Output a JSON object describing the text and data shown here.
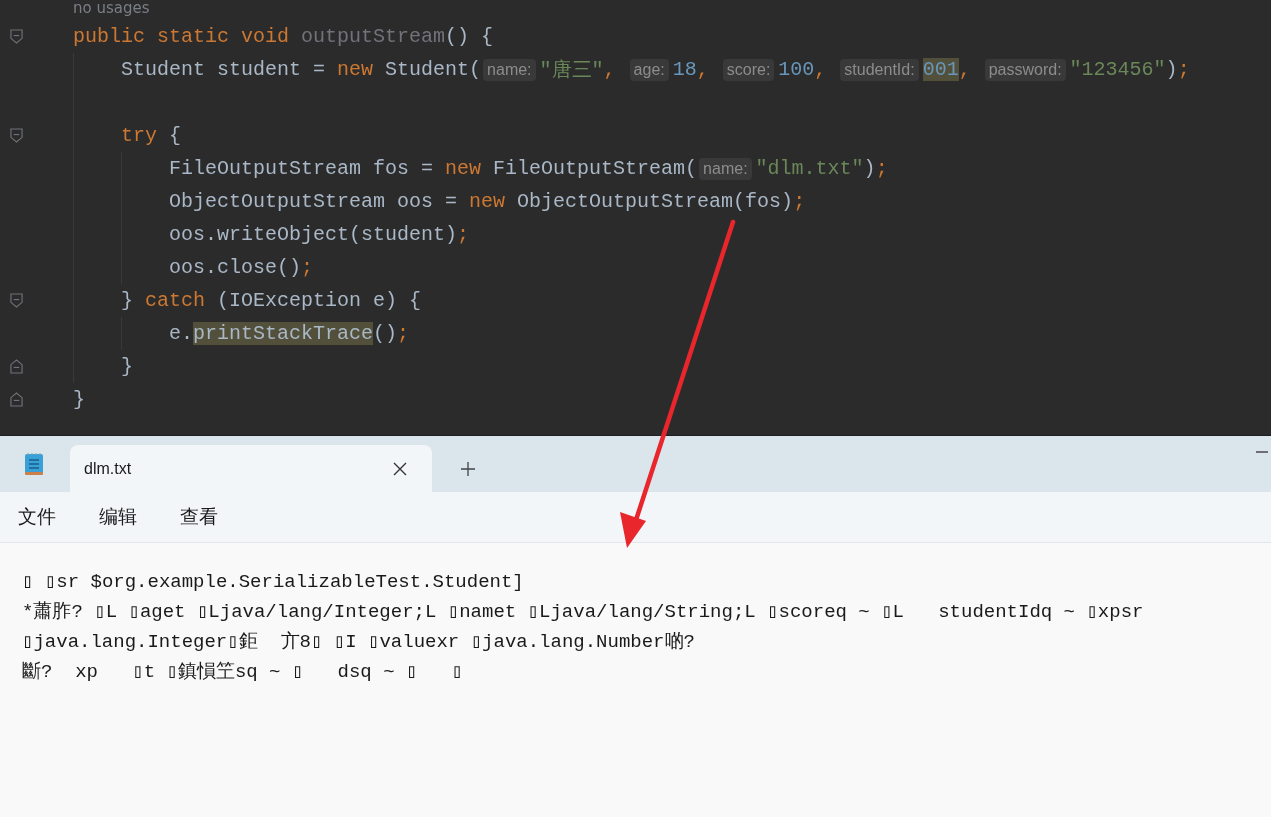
{
  "editor": {
    "lines": [
      {
        "kind": "code",
        "tokens": [
          {
            "kind": "usage",
            "text": "no usages"
          }
        ]
      },
      {
        "kind": "block",
        "tokens": [
          {
            "kind": "keyword",
            "text": "public static void "
          },
          {
            "kind": "unused",
            "text": "outputStream"
          },
          {
            "kind": "plain",
            "text": "() {"
          }
        ],
        "children": [
          {
            "kind": "code",
            "tokens": [
              {
                "kind": "plain",
                "text": "Student student = "
              },
              {
                "kind": "keyword",
                "text": "new "
              },
              {
                "kind": "plain",
                "text": "Student("
              },
              {
                "kind": "hint",
                "text": "name:"
              },
              {
                "kind": "string",
                "text": "\"唐三\""
              },
              {
                "kind": "keyword",
                "text": ", "
              },
              {
                "kind": "hint",
                "text": "age:"
              },
              {
                "kind": "number",
                "text": "18"
              },
              {
                "kind": "keyword",
                "text": ", "
              },
              {
                "kind": "hint",
                "text": "score:"
              },
              {
                "kind": "number",
                "text": "100"
              },
              {
                "kind": "keyword",
                "text": ", "
              },
              {
                "kind": "hint",
                "text": "studentId:"
              },
              {
                "kind": "number",
                "text": "001",
                "highlighted": true
              },
              {
                "kind": "keyword",
                "text": ", "
              },
              {
                "kind": "hint",
                "text": "password:"
              },
              {
                "kind": "string",
                "text": "\"123456\""
              },
              {
                "kind": "plain",
                "text": ")"
              },
              {
                "kind": "keyword",
                "text": ";"
              }
            ]
          },
          {
            "kind": "blank"
          },
          {
            "kind": "block",
            "tokens": [
              {
                "kind": "keyword",
                "text": "try "
              },
              {
                "kind": "plain",
                "text": "{"
              }
            ],
            "children": [
              {
                "kind": "code",
                "tokens": [
                  {
                    "kind": "plain",
                    "text": "FileOutputStream fos = "
                  },
                  {
                    "kind": "keyword",
                    "text": "new "
                  },
                  {
                    "kind": "plain",
                    "text": "FileOutputStream("
                  },
                  {
                    "kind": "hint",
                    "text": "name:"
                  },
                  {
                    "kind": "string",
                    "text": "\"dlm.txt\""
                  },
                  {
                    "kind": "plain",
                    "text": ")"
                  },
                  {
                    "kind": "keyword",
                    "text": ";"
                  }
                ]
              },
              {
                "kind": "code",
                "tokens": [
                  {
                    "kind": "plain",
                    "text": "ObjectOutputStream oos = "
                  },
                  {
                    "kind": "keyword",
                    "text": "new "
                  },
                  {
                    "kind": "plain",
                    "text": "ObjectOutputStream(fos)"
                  },
                  {
                    "kind": "keyword",
                    "text": ";"
                  }
                ]
              },
              {
                "kind": "code",
                "tokens": [
                  {
                    "kind": "plain",
                    "text": "oos.writeObject(student)"
                  },
                  {
                    "kind": "keyword",
                    "text": ";"
                  }
                ]
              },
              {
                "kind": "code",
                "tokens": [
                  {
                    "kind": "plain",
                    "text": "oos.close()"
                  },
                  {
                    "kind": "keyword",
                    "text": ";"
                  }
                ]
              }
            ]
          },
          {
            "kind": "block",
            "tokens": [
              {
                "kind": "plain",
                "text": "} "
              },
              {
                "kind": "keyword",
                "text": "catch "
              },
              {
                "kind": "plain",
                "text": "(IOException e) {"
              }
            ],
            "children": [
              {
                "kind": "code",
                "tokens": [
                  {
                    "kind": "plain",
                    "text": "e."
                  },
                  {
                    "kind": "plain",
                    "text": "printStackTrace",
                    "highlighted": true
                  },
                  {
                    "kind": "plain",
                    "text": "()"
                  },
                  {
                    "kind": "keyword",
                    "text": ";"
                  }
                ]
              }
            ]
          },
          {
            "kind": "closer",
            "tokens": [
              {
                "kind": "plain",
                "text": "}"
              }
            ]
          }
        ]
      },
      {
        "kind": "closer",
        "tokens": [
          {
            "kind": "plain",
            "text": "}"
          }
        ]
      }
    ]
  },
  "notepad": {
    "tabs": [
      {
        "label": "dlm.txt",
        "selected": true
      }
    ],
    "menu": [
      "文件",
      "编辑",
      "查看"
    ],
    "content": [
      "▯ ▯sr $org.example.SerializableTest.Student]",
      "*蕭胙? ▯L ▯aget ▯Ljava/lang/Integer;L ▯namet ▯Ljava/lang/String;L ▯scoreq ~ ▯L   studentIdq ~ ▯xpsr",
      "▯java.lang.Integer▯鉅  亣8▯ ▯I ▯valuexr ▯java.lang.Number啲?",
      "斷?  xp   ▯t ▯鎮愪笁sq ~ ▯   dsq ~ ▯   ▯"
    ]
  }
}
